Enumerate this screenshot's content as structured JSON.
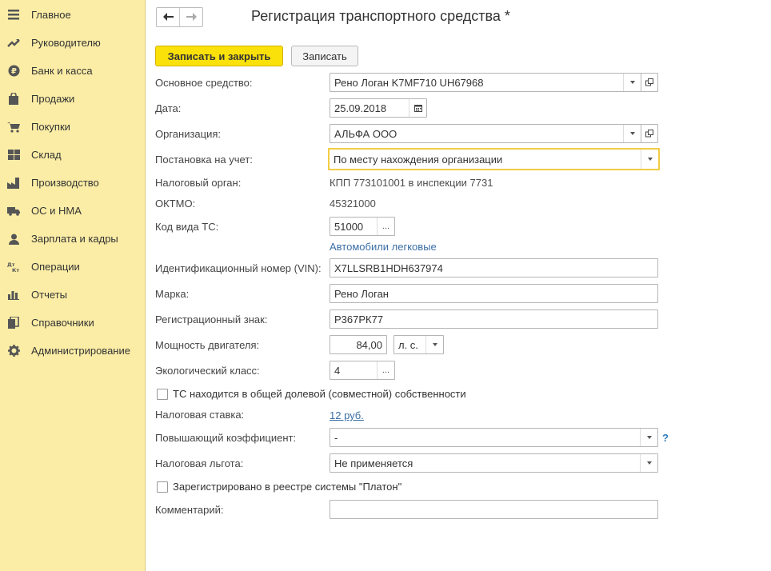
{
  "sidebar": {
    "items": [
      {
        "label": "Главное",
        "icon": "menu-icon"
      },
      {
        "label": "Руководителю",
        "icon": "trend-icon"
      },
      {
        "label": "Банк и касса",
        "icon": "ruble-icon"
      },
      {
        "label": "Продажи",
        "icon": "bag-icon"
      },
      {
        "label": "Покупки",
        "icon": "cart-icon"
      },
      {
        "label": "Склад",
        "icon": "warehouse-icon"
      },
      {
        "label": "Производство",
        "icon": "factory-icon"
      },
      {
        "label": "ОС и НМА",
        "icon": "truck-icon"
      },
      {
        "label": "Зарплата и кадры",
        "icon": "person-icon"
      },
      {
        "label": "Операции",
        "icon": "dt-kt-icon"
      },
      {
        "label": "Отчеты",
        "icon": "bar-chart-icon"
      },
      {
        "label": "Справочники",
        "icon": "books-icon"
      },
      {
        "label": "Администрирование",
        "icon": "gear-icon"
      }
    ]
  },
  "header": {
    "title": "Регистрация транспортного средства *",
    "back_icon": "arrow-left-icon",
    "forward_icon": "arrow-right-icon"
  },
  "toolbar": {
    "save_close_label": "Записать и закрыть",
    "save_label": "Записать"
  },
  "form": {
    "asset_label": "Основное средство:",
    "asset_value": "Рено Логан K7MF710 UH67968",
    "date_label": "Дата:",
    "date_value": "25.09.2018",
    "org_label": "Организация:",
    "org_value": "АЛЬФА ООО",
    "registration_label": "Постановка на учет:",
    "registration_value": "По месту нахождения организации",
    "tax_authority_label": "Налоговый орган:",
    "tax_authority_value": "КПП 773101001 в инспекции 7731",
    "oktmo_label": "ОКТМО:",
    "oktmo_value": "45321000",
    "vehicle_code_label": "Код вида ТС:",
    "vehicle_code_value": "51000",
    "vehicle_code_link": "Автомобили легковые",
    "vin_label": "Идентификационный номер (VIN):",
    "vin_value": "X7LLSRB1HDH637974",
    "brand_label": "Марка:",
    "brand_value": "Рено Логан",
    "plate_label": "Регистрационный знак:",
    "plate_value": "Р367РК77",
    "power_label": "Мощность двигателя:",
    "power_value": "84,00",
    "power_unit": "л. с.",
    "eco_label": "Экологический класс:",
    "eco_value": "4",
    "shared_ownership_label": "ТС находится в общей долевой (совместной) собственности",
    "tax_rate_label": "Налоговая ставка:",
    "tax_rate_value": "12 руб.",
    "coef_label": "Повышающий коэффициент:",
    "coef_value": "-",
    "help_mark": "?",
    "benefit_label": "Налоговая льгота:",
    "benefit_value": "Не применяется",
    "platon_label": "Зарегистрировано в реестре системы \"Платон\"",
    "comment_label": "Комментарий:",
    "comment_value": "",
    "more_button": "..."
  },
  "colors": {
    "sidebar_bg": "#fbeda6",
    "primary_button": "#fbe10a",
    "link": "#3a6ea5",
    "focus_border": "#f2cc43"
  }
}
